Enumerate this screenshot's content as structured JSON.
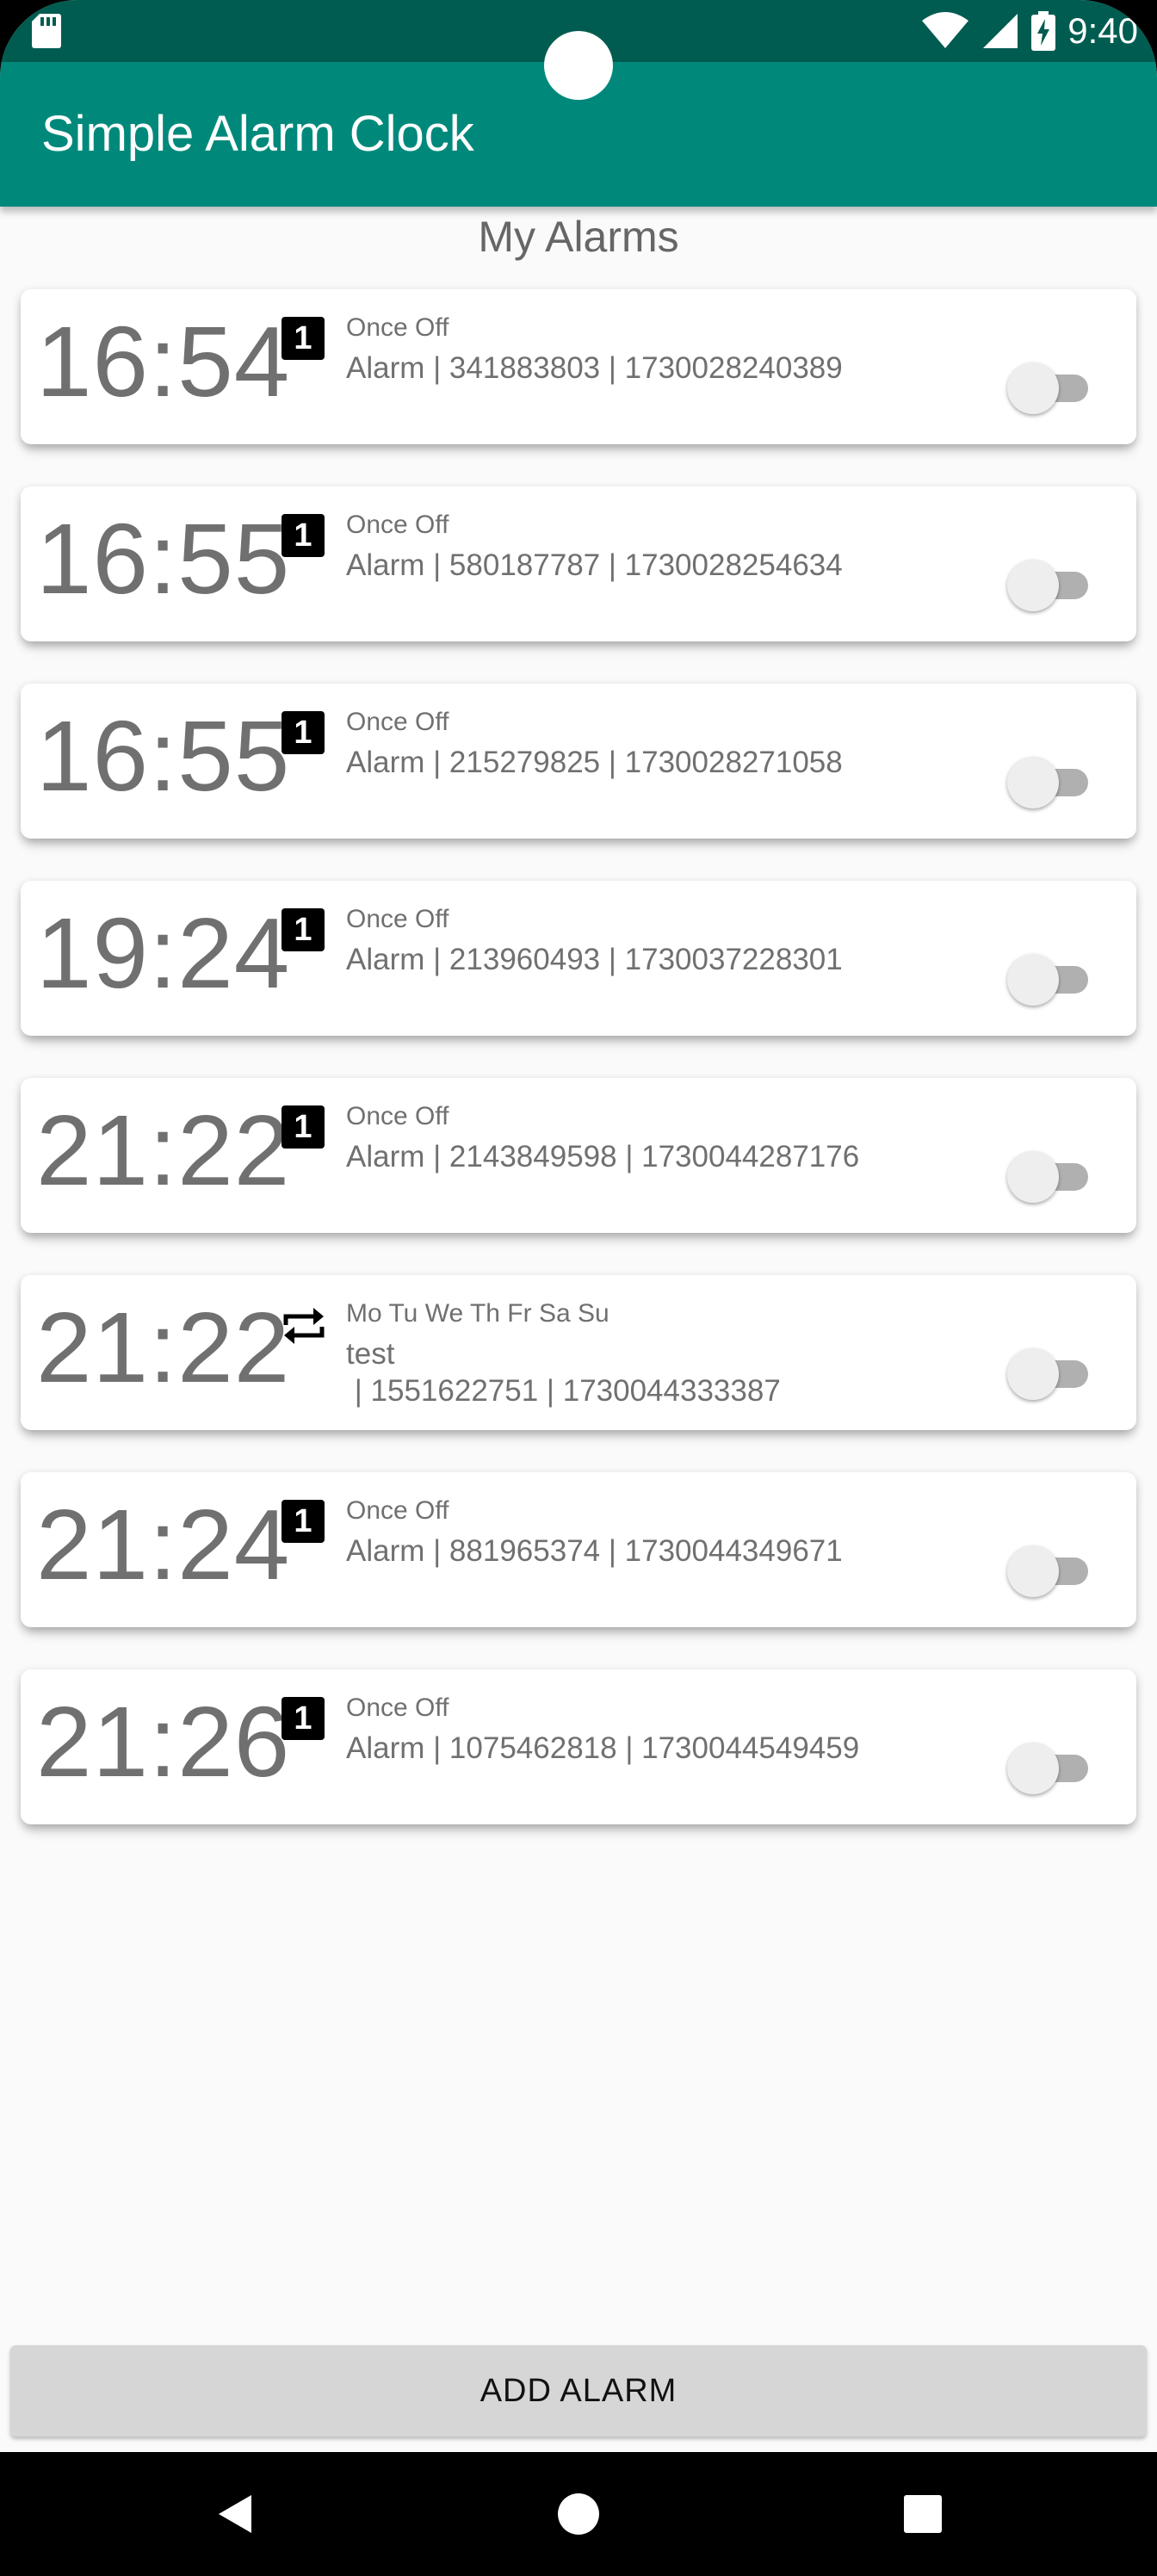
{
  "status_bar": {
    "time": "9:40",
    "icons": [
      "sd-card-icon",
      "wifi-icon",
      "signal-icon",
      "battery-charging-icon"
    ]
  },
  "app_bar": {
    "title": "Simple Alarm Clock"
  },
  "list": {
    "title": "My Alarms",
    "alarms": [
      {
        "time": "16:54",
        "type": "once",
        "badge": "1",
        "days": "Once Off",
        "label": "Alarm | 341883803 | 1730028240389",
        "enabled": false
      },
      {
        "time": "16:55",
        "type": "once",
        "badge": "1",
        "days": "Once Off",
        "label": "Alarm | 580187787 | 1730028254634",
        "enabled": false
      },
      {
        "time": "16:55",
        "type": "once",
        "badge": "1",
        "days": "Once Off",
        "label": "Alarm | 215279825 | 1730028271058",
        "enabled": false
      },
      {
        "time": "19:24",
        "type": "once",
        "badge": "1",
        "days": "Once Off",
        "label": "Alarm | 213960493 | 1730037228301",
        "enabled": false
      },
      {
        "time": "21:22",
        "type": "once",
        "badge": "1",
        "days": "Once Off",
        "label": "Alarm | 2143849598 | 1730044287176",
        "enabled": false
      },
      {
        "time": "21:22",
        "type": "repeat",
        "badge": "",
        "days": "Mo Tu We Th Fr Sa Su",
        "label": "test\n | 1551622751 | 1730044333387",
        "enabled": false
      },
      {
        "time": "21:24",
        "type": "once",
        "badge": "1",
        "days": "Once Off",
        "label": "Alarm | 881965374 | 1730044349671",
        "enabled": false
      },
      {
        "time": "21:26",
        "type": "once",
        "badge": "1",
        "days": "Once Off",
        "label": "Alarm | 1075462818 | 1730044549459",
        "enabled": false
      }
    ]
  },
  "footer": {
    "add_button_label": "ADD ALARM"
  },
  "nav_bar": {
    "buttons": [
      "back-icon",
      "home-icon",
      "recents-icon"
    ]
  },
  "colors": {
    "status_bar": "#005c50",
    "app_bar": "#00897b",
    "background": "#fafafa"
  }
}
